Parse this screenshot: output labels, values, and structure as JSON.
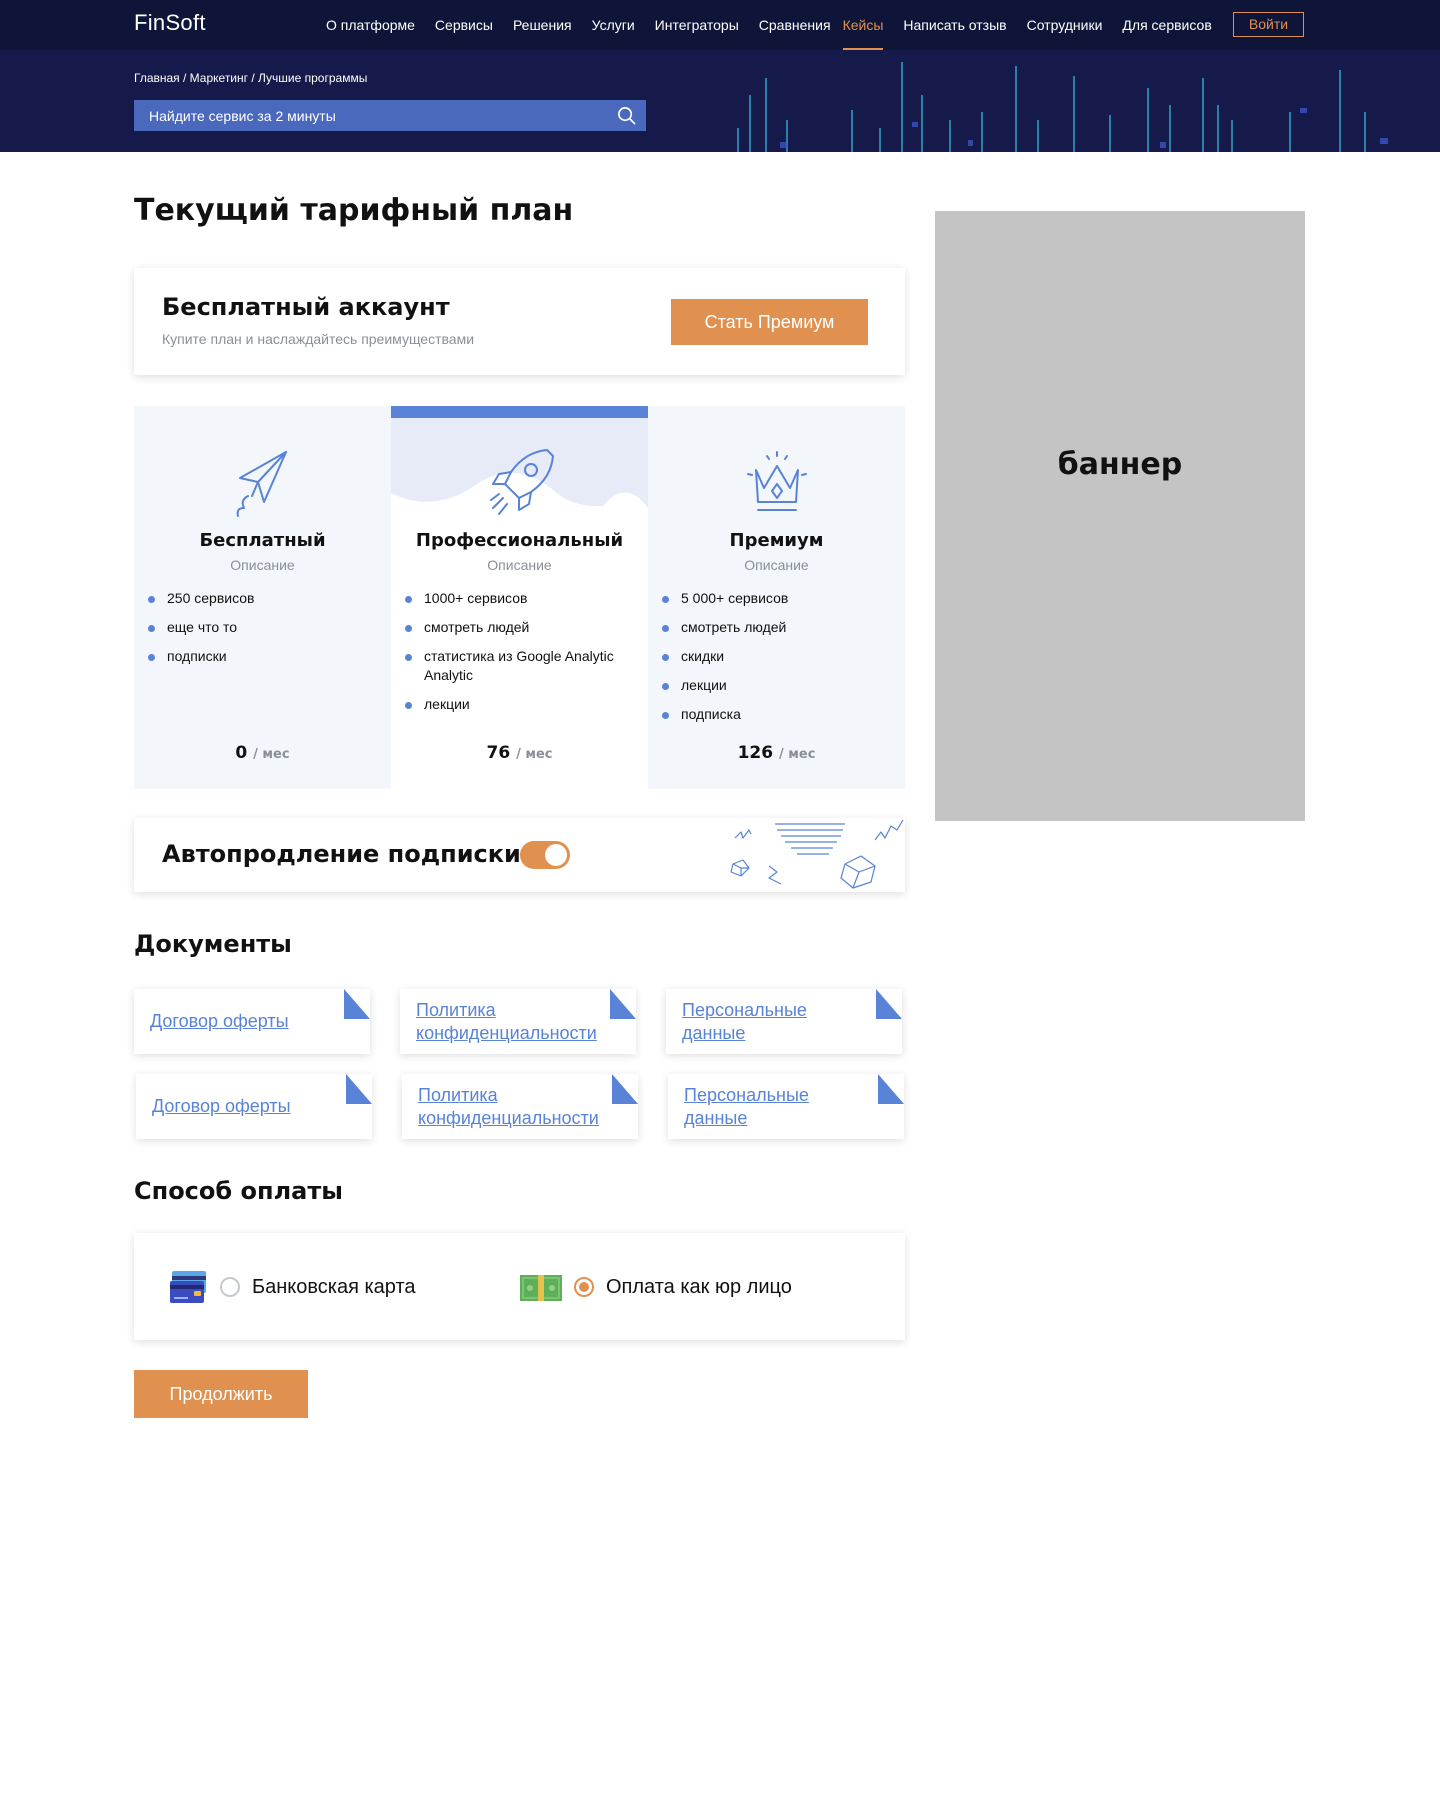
{
  "header": {
    "logo": "FinSoft",
    "nav": [
      "О платформе",
      "Сервисы",
      "Решения",
      "Услуги",
      "Интеграторы",
      "Сравнения",
      "Кейсы",
      "Написать отзыв",
      "Сотрудники",
      "Для сервисов"
    ],
    "active_nav": "Кейсы",
    "login_label": "Войти",
    "breadcrumb": "Главная / Маркетинг / Лучшие программы",
    "search_placeholder": "Найдите сервис за 2 минуты"
  },
  "page": {
    "title": "Текущий тарифный план"
  },
  "account": {
    "title": "Бесплатный аккаунт",
    "subtitle": "Купите план и наслаждайтесь преимуществами",
    "button_label": "Стать Премиум"
  },
  "plans": [
    {
      "name": "Бесплатный",
      "description": "Описание",
      "icon": "paper-plane-icon",
      "features": [
        "250 сервисов",
        "еще что то",
        "подписки"
      ],
      "price": "0",
      "per": "/ мес"
    },
    {
      "name": "Профессиональный",
      "description": "Описание",
      "icon": "rocket-icon",
      "features": [
        "1000+ сервисов",
        "смотреть людей",
        "статистика из Google Analytic Analytic",
        "лекции"
      ],
      "price": "76",
      "per": "/ мес"
    },
    {
      "name": "Премиум",
      "description": "Описание",
      "icon": "crown-icon",
      "features": [
        "5 000+ сервисов",
        "смотреть людей",
        "скидки",
        "лекции",
        "подписка"
      ],
      "price": "126",
      "per": "/ мес"
    }
  ],
  "autorenew": {
    "label": "Автопродление подписки",
    "enabled": true
  },
  "documents": {
    "title": "Документы",
    "items": [
      "Договор оферты",
      "Политика конфиденциальности",
      "Персональные данные",
      "Договор оферты",
      "Политика конфиденциальности",
      "Персональные данные"
    ]
  },
  "payment": {
    "title": "Способ оплаты",
    "options": [
      {
        "label": "Банковская карта",
        "icon": "credit-card-icon",
        "selected": false
      },
      {
        "label": "Оплата как юр лицо",
        "icon": "cash-icon",
        "selected": true
      }
    ],
    "continue_label": "Продолжить"
  },
  "banner": {
    "label": "баннер"
  },
  "colors": {
    "accent": "#e0914f",
    "brand_blue": "#5883d6",
    "header_bg": "#0f1538",
    "hero_bg": "#161a4a"
  }
}
